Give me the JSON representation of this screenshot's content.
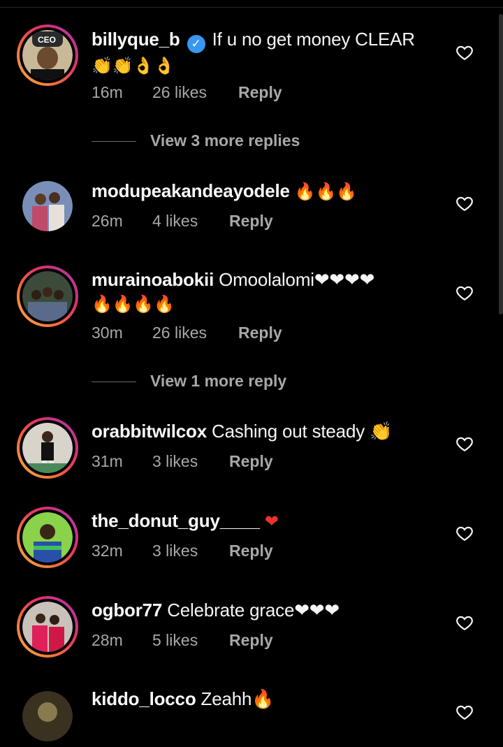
{
  "comments": [
    {
      "username": "billyque_b",
      "verified": true,
      "text": "If u no get money CLEAR",
      "text2": "👏👏👌👌",
      "time": "16m",
      "likes": "26 likes",
      "reply": "Reply"
    },
    {
      "username": "modupeakandeayodele",
      "verified": false,
      "text": "🔥🔥🔥",
      "text2": "",
      "time": "26m",
      "likes": "4 likes",
      "reply": "Reply"
    },
    {
      "username": "murainoabokii",
      "verified": false,
      "text": "Omoolalomi❤❤❤❤",
      "text2": "🔥🔥🔥🔥",
      "time": "30m",
      "likes": "26 likes",
      "reply": "Reply"
    },
    {
      "username": "orabbitwilcox",
      "verified": false,
      "text": "Cashing out steady 👏",
      "text2": "",
      "time": "31m",
      "likes": "3 likes",
      "reply": "Reply"
    },
    {
      "username": "the_donut_guy____",
      "verified": false,
      "text": "❤",
      "text2": "",
      "time": "32m",
      "likes": "3 likes",
      "reply": "Reply"
    },
    {
      "username": "ogbor77",
      "verified": false,
      "text": "Celebrate grace❤❤❤",
      "text2": "",
      "time": "28m",
      "likes": "5 likes",
      "reply": "Reply"
    },
    {
      "username": "kiddo_locco",
      "verified": false,
      "text": "Zeahh🔥",
      "text2": "",
      "time": "",
      "likes": "",
      "reply": ""
    }
  ],
  "view_more": [
    "View 3 more replies",
    "View 1 more reply"
  ],
  "icons": {
    "like": "heart-outline-icon",
    "verified": "verified-badge-icon"
  },
  "colors": {
    "background": "#000000",
    "verified": "#3897f0",
    "secondary_text": "#a8a8a8",
    "story_ring": "#e1306c"
  }
}
